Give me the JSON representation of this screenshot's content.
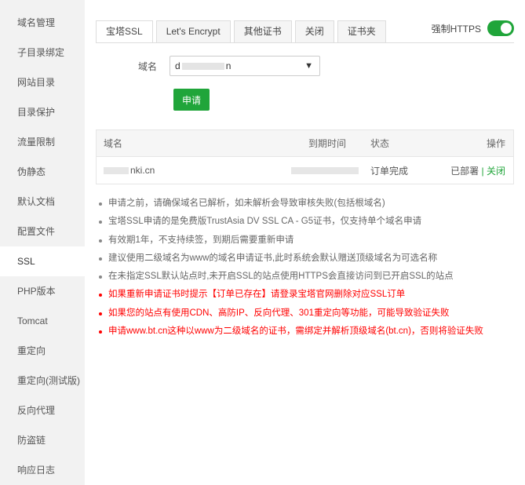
{
  "sidebar": {
    "items": [
      {
        "label": "域名管理"
      },
      {
        "label": "子目录绑定"
      },
      {
        "label": "网站目录"
      },
      {
        "label": "目录保护"
      },
      {
        "label": "流量限制"
      },
      {
        "label": "伪静态"
      },
      {
        "label": "默认文档"
      },
      {
        "label": "配置文件"
      },
      {
        "label": "SSL"
      },
      {
        "label": "PHP版本"
      },
      {
        "label": "Tomcat"
      },
      {
        "label": "重定向"
      },
      {
        "label": "重定向(测试版)"
      },
      {
        "label": "反向代理"
      },
      {
        "label": "防盗链"
      },
      {
        "label": "响应日志"
      }
    ],
    "active": "SSL"
  },
  "tabs": [
    {
      "label": "宝塔SSL"
    },
    {
      "label": "Let's Encrypt"
    },
    {
      "label": "其他证书"
    },
    {
      "label": "关闭"
    },
    {
      "label": "证书夹"
    }
  ],
  "force_https": {
    "label": "强制HTTPS",
    "enabled": true
  },
  "form": {
    "domain_label": "域名",
    "domain_value_start": "d",
    "domain_value_end": "n",
    "apply_label": "申请"
  },
  "table": {
    "headers": {
      "domain": "域名",
      "expire": "到期时间",
      "status": "状态",
      "action": "操作"
    },
    "rows": [
      {
        "domain_suffix": "nki.cn",
        "status": "订单完成",
        "deployed": "已部署",
        "sep": "|",
        "close": "关闭"
      }
    ]
  },
  "tips": [
    {
      "text": "申请之前，请确保域名已解析，如未解析会导致审核失败(包括根域名)",
      "red": false
    },
    {
      "text": "宝塔SSL申请的是免费版TrustAsia DV SSL CA - G5证书，仅支持单个域名申请",
      "red": false
    },
    {
      "text": "有效期1年，不支持续签，到期后需要重新申请",
      "red": false
    },
    {
      "text": "建议使用二级域名为www的域名申请证书,此时系统会默认赠送顶级域名为可选名称",
      "red": false
    },
    {
      "text": "在未指定SSL默认站点时,未开启SSL的站点使用HTTPS会直接访问到已开启SSL的站点",
      "red": false
    },
    {
      "text": "如果重新申请证书时提示【订单已存在】请登录宝塔官网删除对应SSL订单",
      "red": true
    },
    {
      "text": "如果您的站点有使用CDN、高防IP、反向代理、301重定向等功能，可能导致验证失败",
      "red": true
    },
    {
      "text": "申请www.bt.cn这种以www为二级域名的证书，需绑定并解析顶级域名(bt.cn)，否则将验证失败",
      "red": true
    }
  ],
  "colors": {
    "accent": "#20a53a",
    "warning": "#ff0000",
    "sidebar_bg": "#f2f2f2"
  }
}
